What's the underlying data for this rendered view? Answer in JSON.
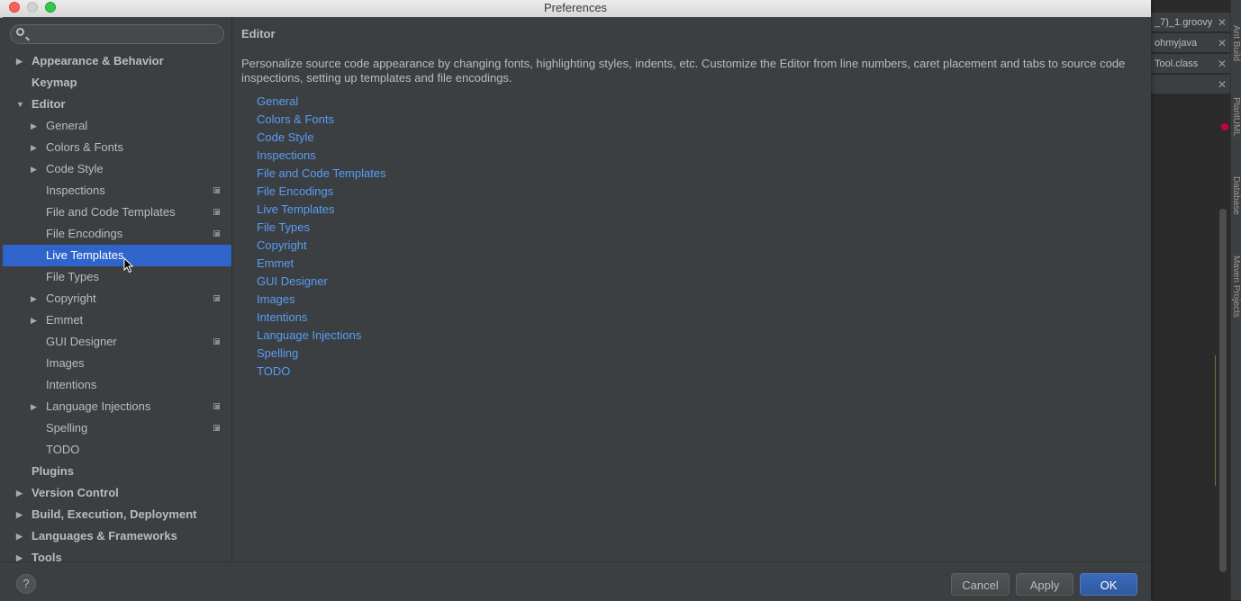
{
  "window": {
    "title": "Preferences"
  },
  "search": {
    "placeholder": ""
  },
  "sidebar": {
    "items": [
      {
        "label": "Appearance & Behavior",
        "level": 0,
        "bold": true,
        "arrow": "right",
        "copy": false
      },
      {
        "label": "Keymap",
        "level": 0,
        "bold": true,
        "arrow": "none",
        "copy": false
      },
      {
        "label": "Editor",
        "level": 0,
        "bold": true,
        "arrow": "down",
        "copy": false
      },
      {
        "label": "General",
        "level": 1,
        "bold": false,
        "arrow": "right",
        "copy": false
      },
      {
        "label": "Colors & Fonts",
        "level": 1,
        "bold": false,
        "arrow": "right",
        "copy": false
      },
      {
        "label": "Code Style",
        "level": 1,
        "bold": false,
        "arrow": "right",
        "copy": false
      },
      {
        "label": "Inspections",
        "level": 1,
        "bold": false,
        "arrow": "none",
        "copy": true
      },
      {
        "label": "File and Code Templates",
        "level": 1,
        "bold": false,
        "arrow": "none",
        "copy": true
      },
      {
        "label": "File Encodings",
        "level": 1,
        "bold": false,
        "arrow": "none",
        "copy": true
      },
      {
        "label": "Live Templates",
        "level": 1,
        "bold": false,
        "arrow": "none",
        "copy": false,
        "selected": true
      },
      {
        "label": "File Types",
        "level": 1,
        "bold": false,
        "arrow": "none",
        "copy": false
      },
      {
        "label": "Copyright",
        "level": 1,
        "bold": false,
        "arrow": "right",
        "copy": true
      },
      {
        "label": "Emmet",
        "level": 1,
        "bold": false,
        "arrow": "right",
        "copy": false
      },
      {
        "label": "GUI Designer",
        "level": 1,
        "bold": false,
        "arrow": "none",
        "copy": true
      },
      {
        "label": "Images",
        "level": 1,
        "bold": false,
        "arrow": "none",
        "copy": false
      },
      {
        "label": "Intentions",
        "level": 1,
        "bold": false,
        "arrow": "none",
        "copy": false
      },
      {
        "label": "Language Injections",
        "level": 1,
        "bold": false,
        "arrow": "right",
        "copy": true
      },
      {
        "label": "Spelling",
        "level": 1,
        "bold": false,
        "arrow": "none",
        "copy": true
      },
      {
        "label": "TODO",
        "level": 1,
        "bold": false,
        "arrow": "none",
        "copy": false
      },
      {
        "label": "Plugins",
        "level": 0,
        "bold": true,
        "arrow": "none",
        "copy": false
      },
      {
        "label": "Version Control",
        "level": 0,
        "bold": true,
        "arrow": "right",
        "copy": false
      },
      {
        "label": "Build, Execution, Deployment",
        "level": 0,
        "bold": true,
        "arrow": "right",
        "copy": false
      },
      {
        "label": "Languages & Frameworks",
        "level": 0,
        "bold": true,
        "arrow": "right",
        "copy": false
      },
      {
        "label": "Tools",
        "level": 0,
        "bold": true,
        "arrow": "right",
        "copy": false
      }
    ]
  },
  "content": {
    "title": "Editor",
    "description": "Personalize source code appearance by changing fonts, highlighting styles, indents, etc. Customize the Editor from line numbers, caret placement and tabs to source code inspections, setting up templates and file encodings.",
    "links": [
      "General",
      "Colors & Fonts",
      "Code Style",
      "Inspections",
      "File and Code Templates",
      "File Encodings",
      "Live Templates",
      "File Types",
      "Copyright",
      "Emmet",
      "GUI Designer",
      "Images",
      "Intentions",
      "Language Injections",
      "Spelling",
      "TODO"
    ]
  },
  "buttons": {
    "help": "?",
    "cancel": "Cancel",
    "apply": "Apply",
    "ok": "OK"
  },
  "ide": {
    "tabs": [
      {
        "label": "_7)_1.groovy"
      },
      {
        "label": "ohmyjava"
      },
      {
        "label": "Tool.class"
      },
      {
        "label": ""
      }
    ],
    "close_glyph": "✕",
    "side_labels": [
      "Ant Build",
      "PlantUML",
      "Database",
      "Maven Projects"
    ]
  },
  "colors": {
    "accent": "#2f65ca",
    "link": "#589df6",
    "panel": "#3c3f41"
  }
}
